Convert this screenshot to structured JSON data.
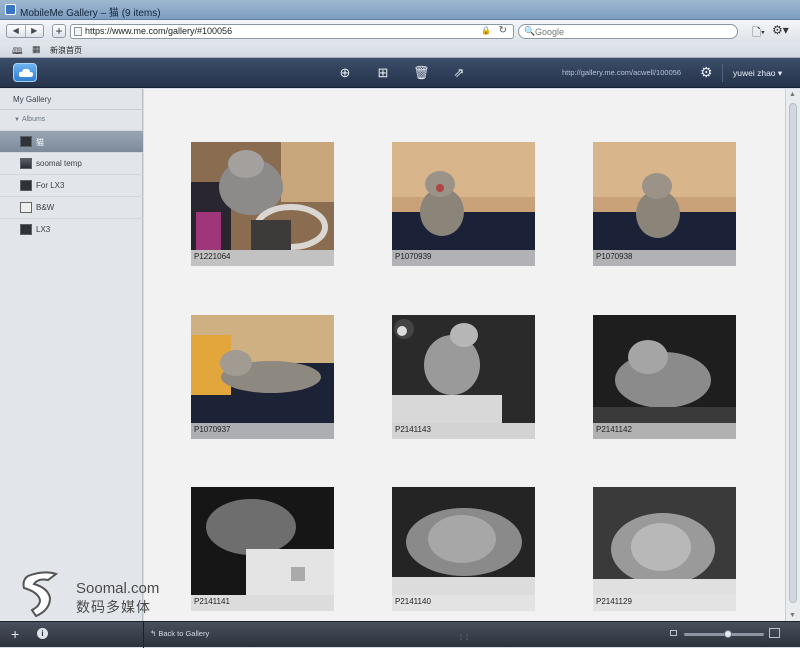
{
  "window": {
    "title": "MobileMe Gallery – 猫 (9 items)"
  },
  "browser": {
    "url": "https://www.me.com/gallery/#100056",
    "search_placeholder": "Google",
    "bookmark_link": "新浪首页"
  },
  "mm_toolbar": {
    "gallery_url": "http://gallery.me.com/acwell/100056",
    "user": "yuwei zhao"
  },
  "sidebar": {
    "header": "My Gallery",
    "albums_label": "Albums",
    "items": [
      {
        "label": "猫",
        "selected": true
      },
      {
        "label": "soomal temp",
        "selected": false
      },
      {
        "label": "For LX3",
        "selected": false
      },
      {
        "label": "B&W",
        "selected": false
      },
      {
        "label": "LX3",
        "selected": false
      }
    ]
  },
  "photos": [
    {
      "caption": "P1221064"
    },
    {
      "caption": "P1070939"
    },
    {
      "caption": "P1070938"
    },
    {
      "caption": "P1070937"
    },
    {
      "caption": "P2141143"
    },
    {
      "caption": "P2141142"
    },
    {
      "caption": "P2141141"
    },
    {
      "caption": "P2141140"
    },
    {
      "caption": "P2141129"
    }
  ],
  "bottombar": {
    "back_label": "Back to Gallery",
    "zoom_level": 0.55
  },
  "watermark": {
    "line1": "Soomal.com",
    "line2": "数码多媒体"
  }
}
